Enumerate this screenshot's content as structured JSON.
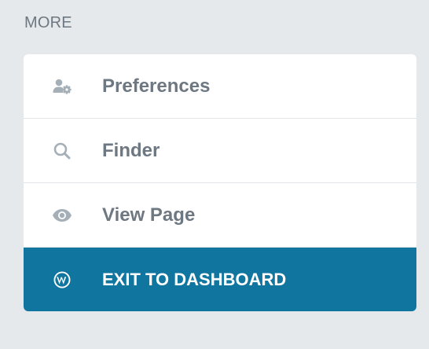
{
  "section": {
    "title": "MORE"
  },
  "menu": {
    "items": [
      {
        "label": "Preferences",
        "icon": "user-gear-icon"
      },
      {
        "label": "Finder",
        "icon": "search-icon"
      },
      {
        "label": "View Page",
        "icon": "eye-icon"
      },
      {
        "label": "EXIT TO DASHBOARD",
        "icon": "wordpress-icon"
      }
    ]
  },
  "colors": {
    "background": "#e6e9ec",
    "card": "#ffffff",
    "text": "#6d7882",
    "icon": "#a4afb7",
    "exit_background": "#11769f",
    "exit_text": "#ffffff"
  }
}
